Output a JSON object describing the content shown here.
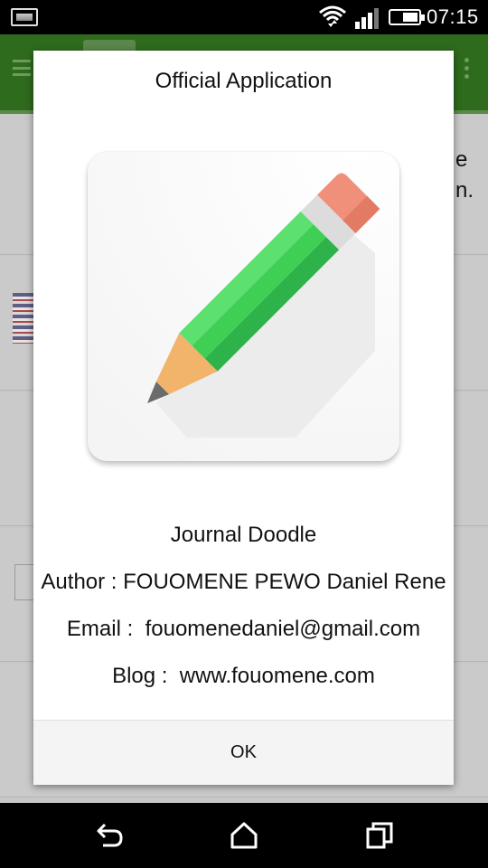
{
  "status_bar": {
    "time": "07:15",
    "icons": [
      "notification-image-icon",
      "wifi-icon",
      "signal-icon",
      "battery-icon"
    ]
  },
  "background_app": {
    "toolbar_color": "#2e6b1c",
    "row_side_text": [
      "e",
      "n."
    ]
  },
  "dialog": {
    "title": "Official Application",
    "app_icon": "pencil-app-icon",
    "app_name": "Journal Doodle",
    "author": "Author : FOUOMENE PEWO Daniel Rene",
    "email": "Email :  fouomenedaniel@gmail.com",
    "blog": "Blog :  www.fouomene.com",
    "ok_label": "OK"
  },
  "nav_bar": {
    "buttons": [
      "back-icon",
      "home-icon",
      "recent-apps-icon"
    ]
  },
  "colors": {
    "pencil_green": "#4cd964",
    "pencil_dark_green": "#2db34a",
    "eraser": "#f0907a",
    "wood": "#f2b46a"
  }
}
